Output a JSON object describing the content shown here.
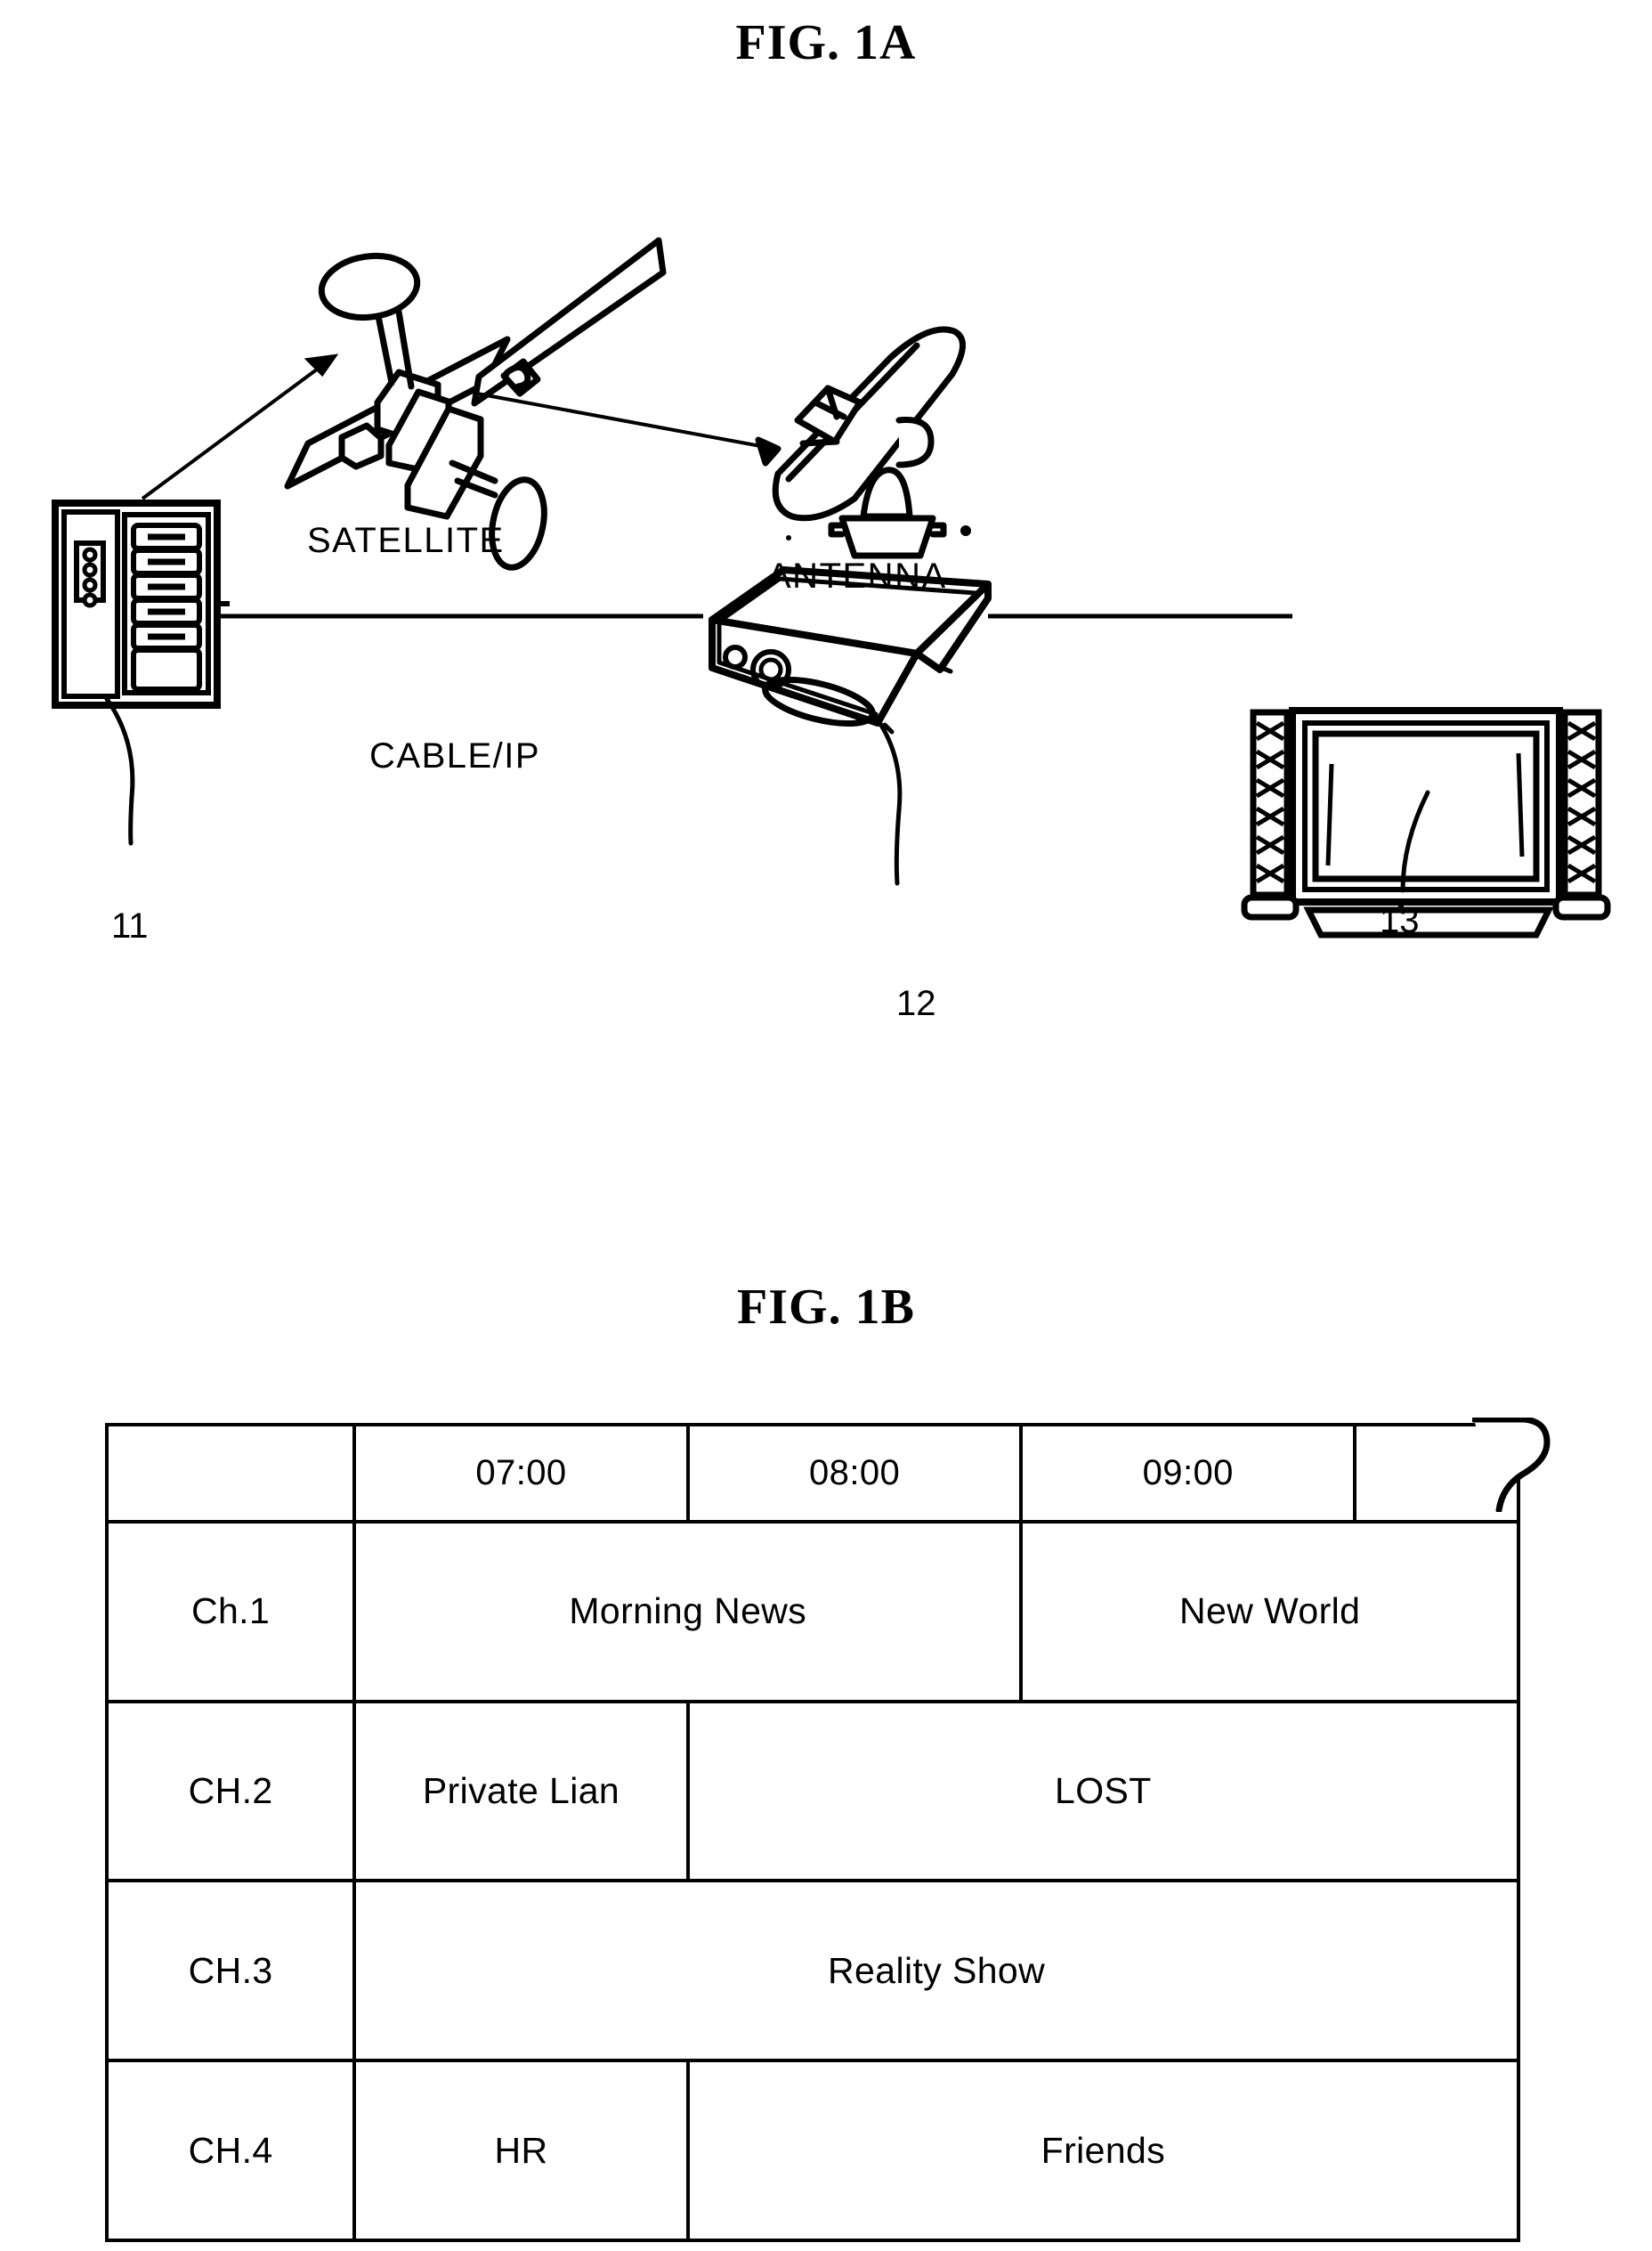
{
  "figures": {
    "fig_a": {
      "title": "FIG. 1A",
      "labels": {
        "satellite": "SATELLITE",
        "antenna": "ANTENNA",
        "cable_ip": "CABLE/IP"
      },
      "reference_numerals": {
        "headend": "11",
        "set_top_box": "12",
        "television": "13"
      }
    },
    "fig_b": {
      "title": "FIG. 1B"
    }
  },
  "chart_data": {
    "type": "table",
    "title": "FIG. 1B",
    "description": "Electronic program guide grid",
    "column_headers": [
      "",
      "07:00",
      "08:00",
      "09:00",
      ""
    ],
    "row_headers": [
      "Ch.1",
      "CH.2",
      "CH.3",
      "CH.4"
    ],
    "rows": [
      {
        "channel": "Ch.1",
        "programs": [
          {
            "title": "Morning News",
            "span": 2
          },
          {
            "title": "New World",
            "span": 2
          }
        ]
      },
      {
        "channel": "CH.2",
        "programs": [
          {
            "title": "Private Lian",
            "span": 1.5
          },
          {
            "title": "LOST",
            "span": 2.5
          }
        ]
      },
      {
        "channel": "CH.3",
        "programs": [
          {
            "title": "Reality Show",
            "span": 4
          }
        ]
      },
      {
        "channel": "CH.4",
        "programs": [
          {
            "title": "HR",
            "span": 1
          },
          {
            "title": "Friends",
            "span": 3
          }
        ]
      }
    ]
  }
}
